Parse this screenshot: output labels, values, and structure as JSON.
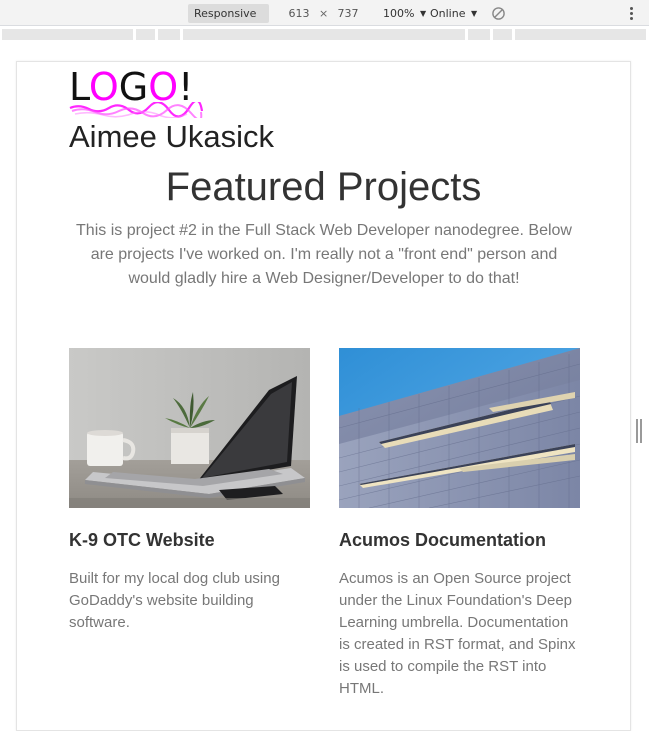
{
  "devtools": {
    "device_label": "Responsive",
    "width_value": "613",
    "times_sign": "×",
    "height_value": "737",
    "zoom_label": "100%",
    "throttle_label": "Online",
    "caret": "▼"
  },
  "page": {
    "logo": {
      "text_l": "L",
      "text_o1": "O",
      "text_g": "G",
      "text_o2": "O",
      "text_bang": "!",
      "accent_color": "#ff00ff"
    },
    "name": "Aimee Ukasick",
    "headline": "Featured Projects",
    "intro": "This is project #2 in the Full Stack Web Developer nanodegree. Below are projects I've worked on. I'm really not a \"front end\" person and would gladly hire a Web Designer/Developer to do that!",
    "projects": [
      {
        "image": "laptop-on-desk-photo",
        "title": "K-9 OTC Website",
        "description": "Built for my local dog club using GoDaddy's website building software."
      },
      {
        "image": "building-facade-photo",
        "title": "Acumos Documentation",
        "description": "Acumos is an Open Source project under the Linux Foundation's Deep Learning umbrella. Documentation is created in RST format, and Spinx is used to compile the RST into HTML."
      }
    ]
  }
}
